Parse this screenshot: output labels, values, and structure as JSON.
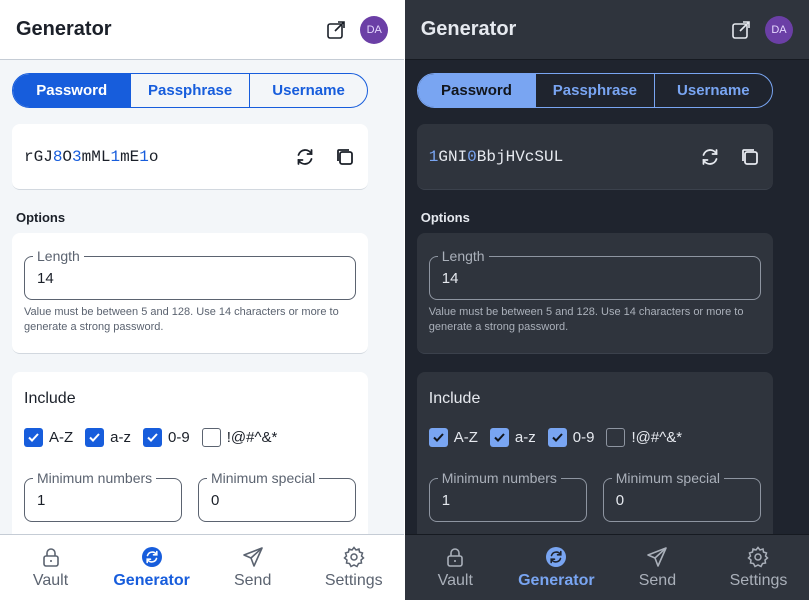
{
  "header": {
    "title": "Generator",
    "avatar_initials": "DA"
  },
  "tabs": [
    {
      "label": "Password",
      "active": true
    },
    {
      "label": "Passphrase",
      "active": false
    },
    {
      "label": "Username",
      "active": false
    }
  ],
  "light": {
    "password_segments": [
      {
        "text": "rGJ",
        "num": false
      },
      {
        "text": "8",
        "num": true
      },
      {
        "text": "O",
        "num": false
      },
      {
        "text": "3",
        "num": true
      },
      {
        "text": "mML",
        "num": false
      },
      {
        "text": "1",
        "num": true
      },
      {
        "text": "mE",
        "num": false
      },
      {
        "text": "1",
        "num": true
      },
      {
        "text": "o",
        "num": false
      }
    ]
  },
  "dark": {
    "password_segments": [
      {
        "text": "1",
        "num": true
      },
      {
        "text": "GNI",
        "num": false
      },
      {
        "text": "0",
        "num": true
      },
      {
        "text": "BbjHVcSUL",
        "num": false
      }
    ]
  },
  "options_label": "Options",
  "length": {
    "label": "Length",
    "value": "14",
    "hint": "Value must be between 5 and 128. Use 14 characters or more to generate a strong password."
  },
  "include": {
    "title": "Include",
    "checks": [
      {
        "label": "A-Z",
        "checked": true
      },
      {
        "label": "a-z",
        "checked": true
      },
      {
        "label": "0-9",
        "checked": true
      },
      {
        "label": "!@#^&*",
        "checked": false
      }
    ],
    "min_numbers": {
      "label": "Minimum numbers",
      "value": "1"
    },
    "min_special": {
      "label": "Minimum special",
      "value": "0"
    }
  },
  "nav": [
    {
      "label": "Vault",
      "icon": "lock-icon",
      "active": false
    },
    {
      "label": "Generator",
      "icon": "generator-icon",
      "active": true
    },
    {
      "label": "Send",
      "icon": "send-icon",
      "active": false
    },
    {
      "label": "Settings",
      "icon": "gear-icon",
      "active": false
    }
  ],
  "colors": {
    "light_accent": "#175ddc",
    "dark_accent": "#79a5f2",
    "avatar": "#6b3fa6"
  }
}
